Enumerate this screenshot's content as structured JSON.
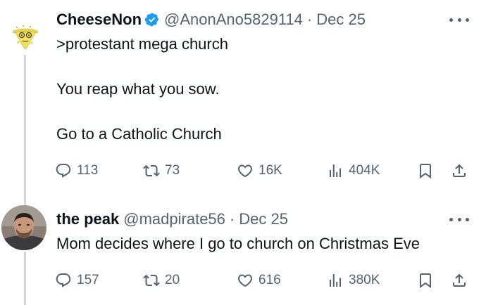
{
  "tweets": [
    {
      "name": "CheeseNon",
      "verified": true,
      "handle": "@AnonAno5829114",
      "separator": "·",
      "date": "Dec 25",
      "text_lines": [
        ">protestant mega church",
        "You reap what you sow.",
        "Go to a Catholic Church"
      ],
      "stats": {
        "replies": "113",
        "reposts": "73",
        "likes": "16K",
        "views": "404K"
      },
      "avatar_icon": "cheese-face-avatar",
      "colors": {
        "verified": "#1d9bf0",
        "avatar": "#f7e35a"
      }
    },
    {
      "name": "the peak",
      "verified": false,
      "handle": "@madpirate56",
      "separator": "·",
      "date": "Dec 25",
      "text_lines": [
        "Mom decides where I go to church on Christmas Eve"
      ],
      "stats": {
        "replies": "157",
        "reposts": "20",
        "likes": "616",
        "views": "380K"
      },
      "avatar_icon": "user-photo-avatar"
    }
  ],
  "icons": {
    "reply": "reply-icon",
    "repost": "repost-icon",
    "like": "like-icon",
    "views": "views-icon",
    "bookmark": "bookmark-icon",
    "share": "share-icon",
    "more": "more-icon",
    "verified": "verified-badge-icon"
  },
  "colors": {
    "text": "#0f1419",
    "secondary": "#536471",
    "thread_line": "#cfd9de"
  }
}
